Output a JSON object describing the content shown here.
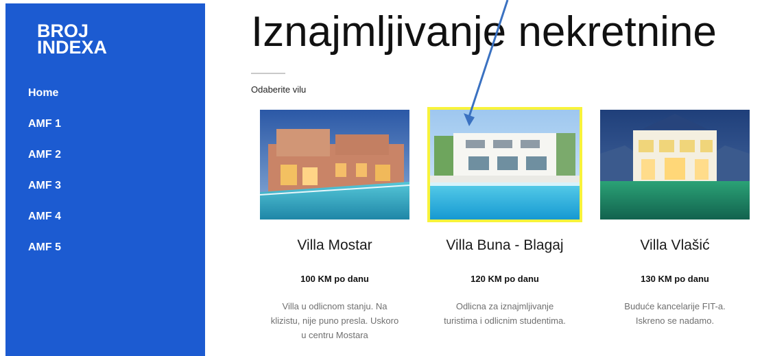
{
  "sidebar": {
    "brand_line1": "BROJ",
    "brand_line2": "INDEXA",
    "items": [
      {
        "label": "Home"
      },
      {
        "label": "AMF 1"
      },
      {
        "label": "AMF 2"
      },
      {
        "label": "AMF 3"
      },
      {
        "label": "AMF 4"
      },
      {
        "label": "AMF 5"
      }
    ]
  },
  "main": {
    "title": "Iznajmljivanje nekretnine",
    "subtitle": "Odaberite vilu"
  },
  "villas": [
    {
      "name": "Villa Mostar",
      "price": "100 KM po danu",
      "desc": "Villa u odlicnom stanju. Na klizistu, nije puno presla. Uskoro u centru Mostara",
      "selected": false
    },
    {
      "name": "Villa Buna - Blagaj",
      "price": "120 KM po danu",
      "desc": "Odlicna za iznajmljivanje turistima i odlicnim studentima.",
      "selected": true
    },
    {
      "name": "Villa Vlašić",
      "price": "130 KM po danu",
      "desc": "Buduće kancelarije FIT-a. Iskreno se nadamo.",
      "selected": false
    }
  ],
  "colors": {
    "sidebar": "#1c5bd1",
    "selected_outline": "#f8f33b",
    "arrow": "#3a71c1"
  }
}
